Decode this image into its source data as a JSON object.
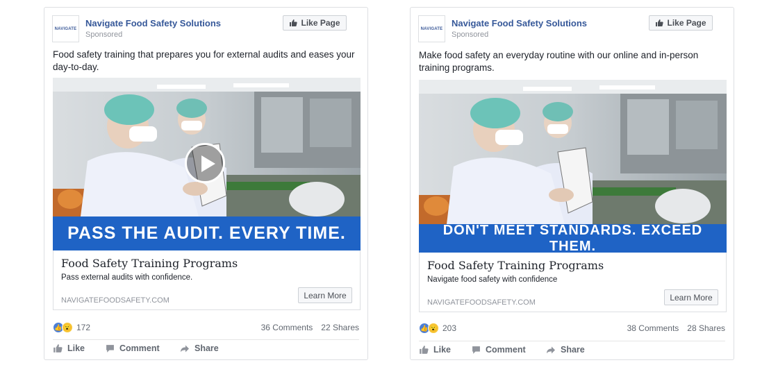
{
  "posts": [
    {
      "page_name": "Navigate Food Safety Solutions",
      "sponsored": "Sponsored",
      "logo_text": "NAVIGATE",
      "like_page": "Like Page",
      "text": "Food safety training that prepares you for external audits and eases your day-to-day.",
      "banner": "PASS THE AUDIT. EVERY TIME.",
      "has_video": true,
      "link_title": "Food Safety Training Programs",
      "link_desc": "Pass external audits with confidence.",
      "link_domain": "NAVIGATEFOODSAFETY.COM",
      "learn_more": "Learn More",
      "reaction_count": "172",
      "comments": "36 Comments",
      "shares": "22 Shares",
      "actions": {
        "like": "Like",
        "comment": "Comment",
        "share": "Share"
      }
    },
    {
      "page_name": "Navigate Food Safety Solutions",
      "sponsored": "Sponsored",
      "logo_text": "NAVIGATE",
      "like_page": "Like Page",
      "text": "Make food safety an everyday routine with our online and in-person training programs.",
      "banner": "DON'T MEET STANDARDS. EXCEED THEM.",
      "has_video": false,
      "link_title": "Food Safety Training Programs",
      "link_desc": "Navigate food safety with confidence",
      "link_domain": "NAVIGATEFOODSAFETY.COM",
      "learn_more": "Learn More",
      "reaction_count": "203",
      "comments": "38 Comments",
      "shares": "28 Shares",
      "actions": {
        "like": "Like",
        "comment": "Comment",
        "share": "Share"
      }
    }
  ],
  "colors": {
    "link_blue": "#365899",
    "banner_blue": "#1f63c5",
    "muted": "#90949c"
  }
}
